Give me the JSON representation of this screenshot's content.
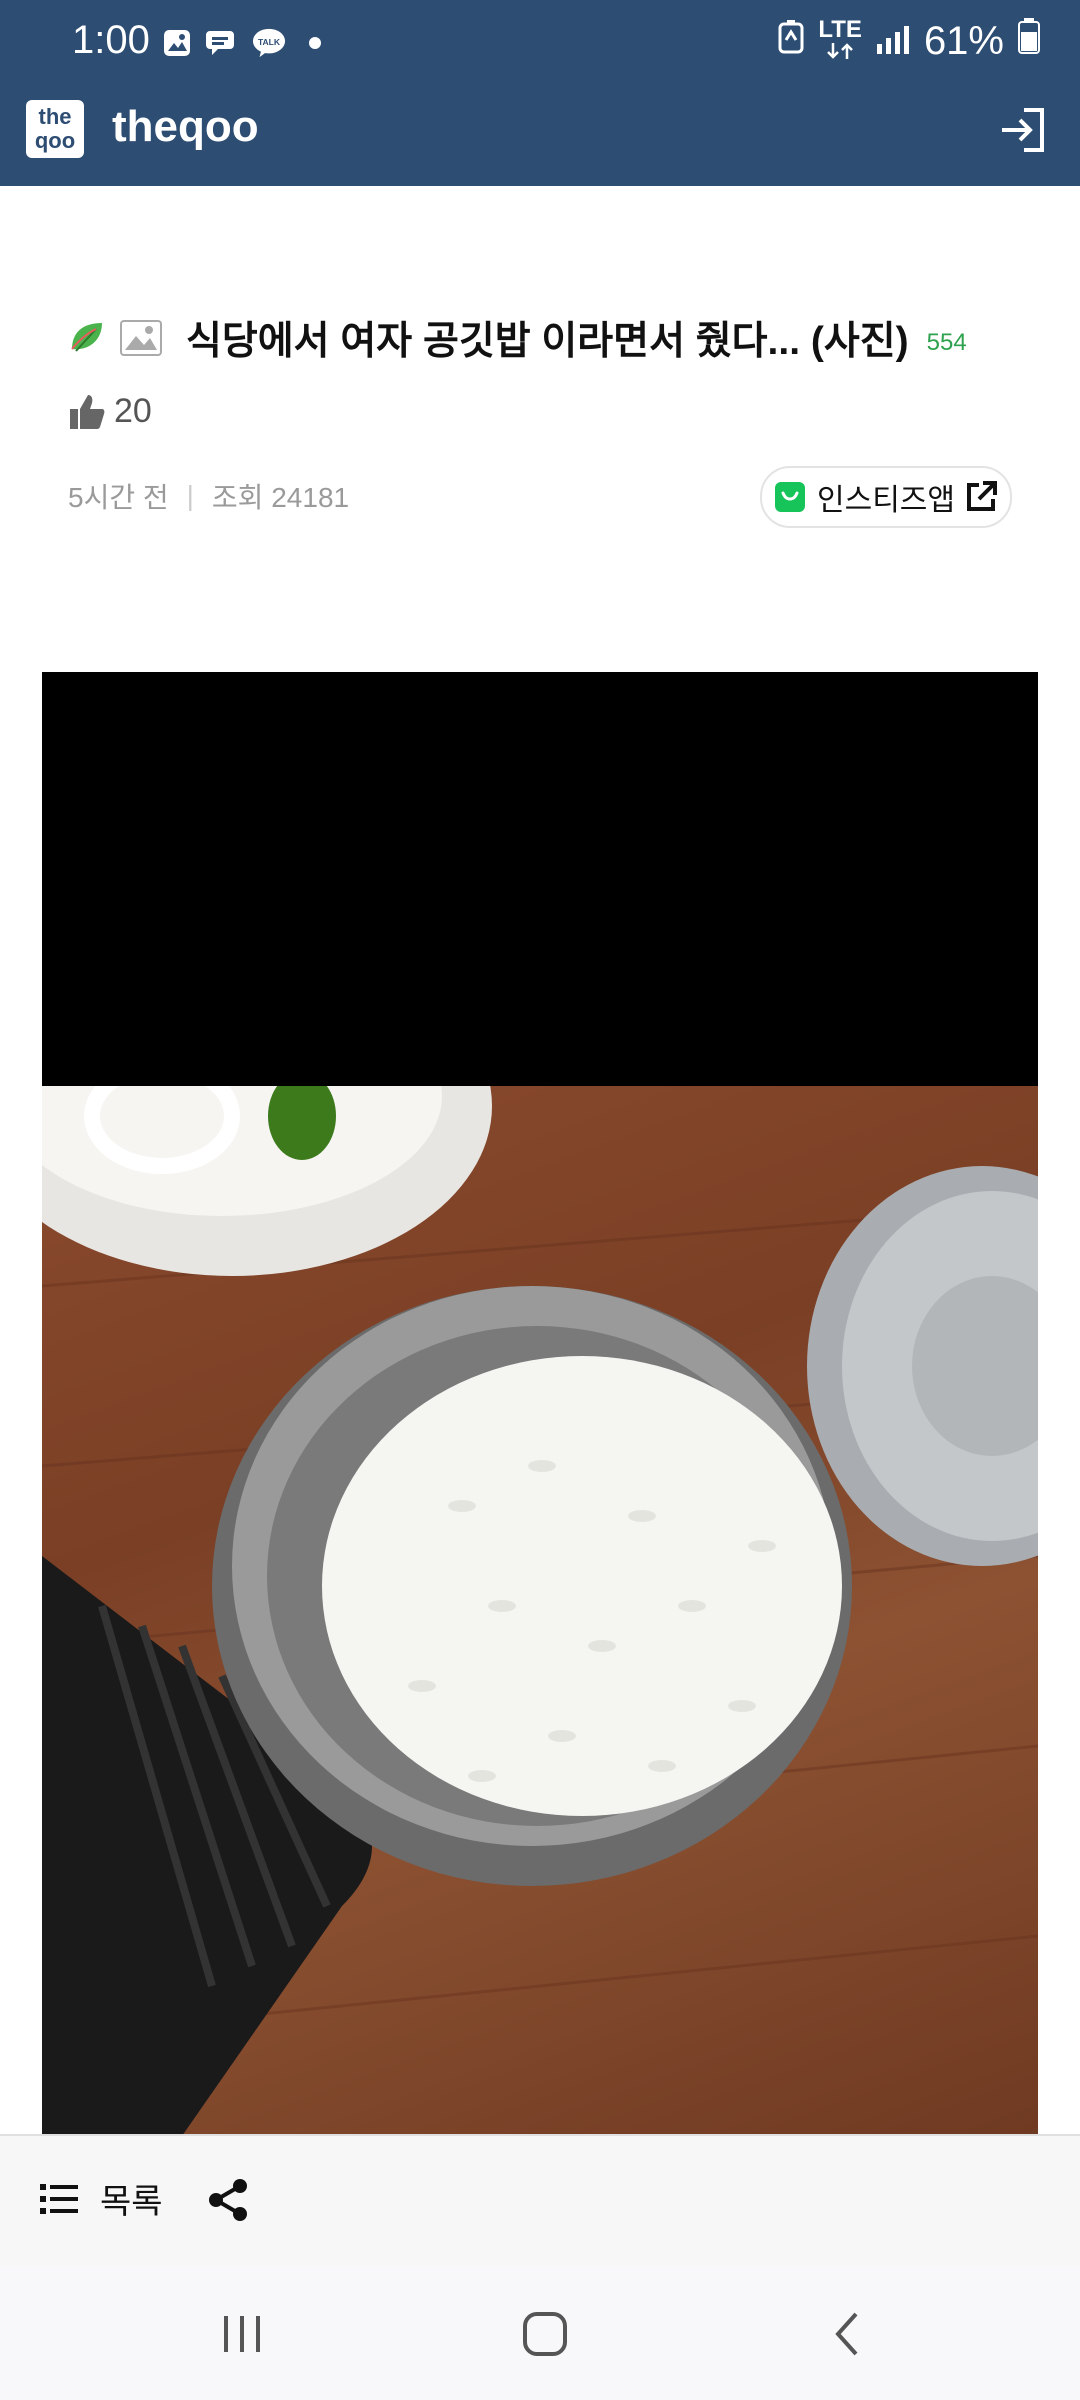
{
  "status_bar": {
    "time": "1:00",
    "network": "LTE",
    "battery": "61%",
    "notification_icons": [
      "gallery-icon",
      "chat-bubble-icon",
      "kakaotalk-icon",
      "dot-icon"
    ]
  },
  "app": {
    "logo_top": "the",
    "logo_bottom": "qoo",
    "title": "theqoo"
  },
  "post": {
    "title": "식당에서 여자 공깃밥 이라면서 줬다... (사진)",
    "comment_count": "554",
    "likes": "20",
    "time_ago": "5시간 전",
    "views": "조회 24181",
    "insti_button": "인스티즈앱"
  },
  "toolbar": {
    "list_label": "목록"
  },
  "colors": {
    "header_bg": "#2d4d73",
    "comment_green": "#2fa24f",
    "insti_green": "#16c45a"
  }
}
